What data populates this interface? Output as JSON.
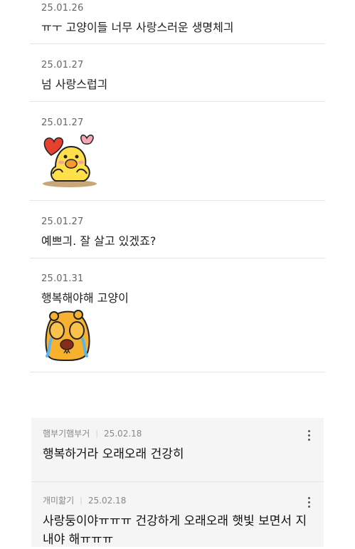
{
  "entries": [
    {
      "date": "25.01.26",
      "text": "ㅠㅜ 고양이들 너무 사랑스러운 생명체긔"
    },
    {
      "date": "25.01.27",
      "text": "넘 사랑스럽긔"
    },
    {
      "date": "25.01.27",
      "text": ""
    },
    {
      "date": "25.01.27",
      "text": "예쁘긔. 잘 살고 있겠죠?"
    },
    {
      "date": "25.01.31",
      "text": "행복해야해 고양이"
    }
  ],
  "stickers": [
    {
      "icon": "love-chick-sticker-icon"
    },
    {
      "icon": "crying-bear-sticker-icon"
    }
  ],
  "comments": [
    {
      "author": "햄부기햄부거",
      "date": "25.02.18",
      "text": "행복하거라 오래오래 건강히"
    },
    {
      "author": "개미핢기",
      "date": "25.02.18",
      "text": "사랑둥이야ㅠㅠㅠ 건강하게 오래오래 햇빛 보면서 지내야 해ㅠㅠㅠ"
    }
  ],
  "colors": {
    "comment_bg": "#f5f5f5",
    "chick": "#ffe04a",
    "bear": "#f6b22e",
    "heart": "#e8402f"
  }
}
